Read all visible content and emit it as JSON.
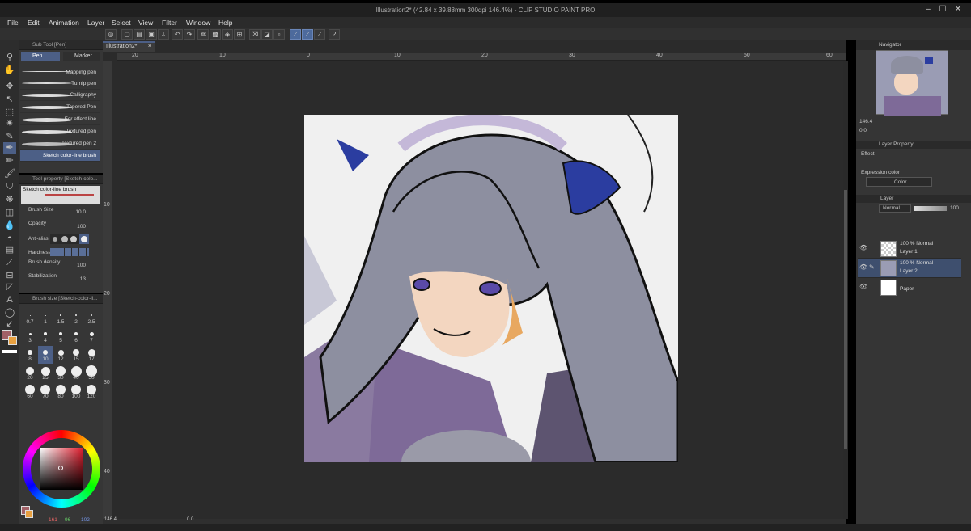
{
  "app": {
    "title": "Illustration2* (42.84 x 39.88mm 300dpi 146.4%) - CLIP STUDIO PAINT PRO"
  },
  "menu": [
    "File",
    "Edit",
    "Animation",
    "Layer",
    "Select",
    "View",
    "Filter",
    "Window",
    "Help"
  ],
  "doc_tab": {
    "label": "Illustration2*",
    "close": "×"
  },
  "subtool": {
    "header": "Sub Tool [Pen]",
    "tabs": [
      "Pen",
      "Marker"
    ],
    "brushes": [
      "Mapping pen",
      "Turnip pen",
      "Calligraphy",
      "Tapered Pen",
      "For effect line",
      "Textured pen",
      "Textured pen 2",
      "Sketch color-line brush"
    ]
  },
  "tool_property": {
    "header": "Tool property [Sketch-colo...",
    "brush_name": "Sketch color-line brush",
    "brush_size_label": "Brush Size",
    "brush_size_value": "10.0",
    "opacity_label": "Opacity",
    "opacity_value": "100",
    "antialias_label": "Anti-alias",
    "hardness_label": "Hardness",
    "density_label": "Brush density",
    "density_value": "100",
    "stabilization_label": "Stabilization",
    "stabilization_value": "13"
  },
  "brush_size_panel": {
    "header": "Brush size [Sketch-color-li...",
    "sizes": [
      "0.7",
      "1",
      "1.5",
      "2",
      "2.5",
      "3",
      "4",
      "5",
      "6",
      "7",
      "8",
      "10",
      "12",
      "15",
      "17",
      "20",
      "25",
      "30",
      "40",
      "50",
      "60",
      "70",
      "80",
      "100",
      "120"
    ],
    "selected": "10"
  },
  "color_values": {
    "r": "161",
    "g": "96",
    "b": "102"
  },
  "ruler_h": [
    "20",
    "10",
    "0",
    "10",
    "20",
    "30",
    "40",
    "50",
    "60"
  ],
  "ruler_v": [
    "10",
    "20",
    "30",
    "40"
  ],
  "canvas_zoom": "146.4",
  "canvas_rotation": "0.0",
  "navigator": {
    "header": "Navigator",
    "zoom": "146.4",
    "rotation": "0.0"
  },
  "layer_property": {
    "header": "Layer Property",
    "effect_label": "Effect",
    "expression_label": "Expression color",
    "expression_value": "Color"
  },
  "layer_panel": {
    "header": "Layer",
    "blend_mode": "Normal",
    "opacity": "100",
    "layers": [
      {
        "mode": "100 % Normal",
        "name": "Layer 1"
      },
      {
        "mode": "100 % Normal",
        "name": "Layer 2"
      },
      {
        "mode": "",
        "name": "Paper"
      }
    ]
  },
  "colors": {
    "accent": "#4c5f86",
    "main_color": "#a16066",
    "sub_color": "#e8a040"
  }
}
